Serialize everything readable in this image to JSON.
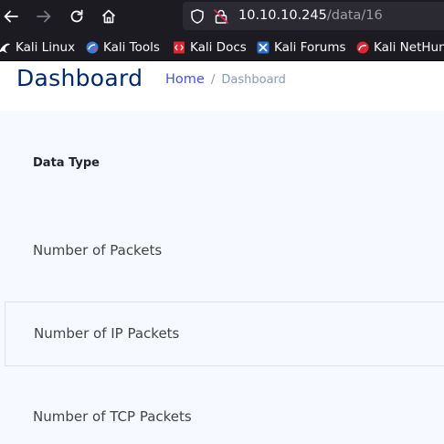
{
  "browser": {
    "url_host": "10.10.10.245",
    "url_path": "/data/16",
    "nav": [
      "back-icon",
      "forward-icon",
      "reload-icon",
      "home-icon"
    ],
    "bookmarks": [
      {
        "label": "Kali Linux",
        "icon": "kali-dragon-icon"
      },
      {
        "label": "Kali Tools",
        "icon": "kali-tools-icon"
      },
      {
        "label": "Kali Docs",
        "icon": "kali-docs-icon"
      },
      {
        "label": "Kali Forums",
        "icon": "kali-forums-icon"
      },
      {
        "label": "Kali NetHun",
        "icon": "kali-nethunter-icon"
      }
    ]
  },
  "header": {
    "title": "Dashboard",
    "breadcrumb": {
      "home": "Home",
      "separator": "/",
      "current": "Dashboard"
    }
  },
  "table": {
    "header": "Data Type",
    "rows": [
      "Number of Packets",
      "Number of IP Packets",
      "Number of TCP Packets"
    ]
  },
  "colors": {
    "browser_chrome": "#1c1b22",
    "urlbar": "#2b2a33",
    "title": "#012970",
    "link": "#4154f1",
    "main_bg": "#f6f9ff"
  }
}
